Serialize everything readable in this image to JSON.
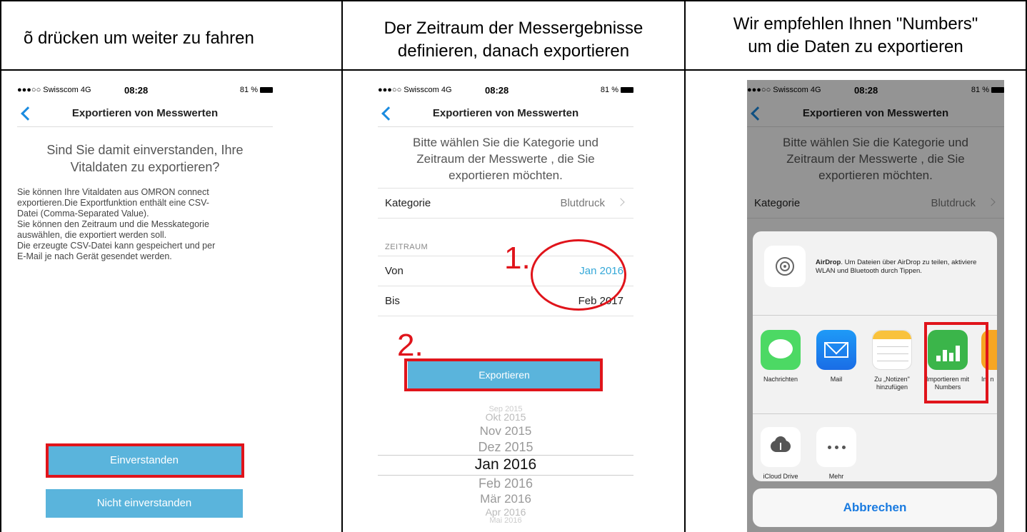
{
  "columns": [
    {
      "title": "õ  drücken um weiter zu fahren"
    },
    {
      "title_line1": "Der Zeitraum der Messergebnisse",
      "title_line2": "definieren, danach exportieren"
    },
    {
      "title_line1": "Wir empfehlen Ihnen \"Numbers\"",
      "title_line2": "um die Daten zu exportieren"
    }
  ],
  "status": {
    "carrier": "●●●○○ Swisscom  4G",
    "time": "08:28",
    "battery": "81 %"
  },
  "nav_title": "Exportieren von Messwerten",
  "screen1": {
    "question_line1": "Sind Sie damit einverstanden, Ihre",
    "question_line2": "Vitaldaten zu exportieren?",
    "body_lines": [
      "Sie können Ihre Vitaldaten aus OMRON connect",
      "exportieren.Die Exportfunktion enthält eine CSV-",
      "Datei (Comma-Separated Value).",
      "Sie können den Zeitraum und die Messkategorie",
      "auswählen, die exportiert werden soll.",
      "Die erzeugte CSV-Datei kann gespeichert und per",
      "E-Mail je nach Gerät gesendet werden."
    ],
    "agree_label": "Einverstanden",
    "disagree_label": "Nicht einverstanden"
  },
  "screen2": {
    "intro_line1": "Bitte wählen Sie die Kategorie und",
    "intro_line2": "Zeitraum der Messwerte , die Sie",
    "intro_line3": "exportieren möchten.",
    "category_label": "Kategorie",
    "category_value": "Blutdruck",
    "section_header": "ZEITRAUM",
    "from_label": "Von",
    "from_value": "Jan 2016",
    "to_label": "Bis",
    "to_value": "Feb 2017",
    "export_label": "Exportieren",
    "picker": [
      "Sep 2015",
      "Okt 2015",
      "Nov 2015",
      "Dez 2015",
      "Jan 2016",
      "Feb 2016",
      "Mär 2016",
      "Apr 2016",
      "Mai 2016"
    ]
  },
  "annotations": {
    "step1": "1.",
    "step2": "2.",
    "color": "#e0141b"
  },
  "screen3": {
    "airdrop_bold": "AirDrop",
    "airdrop_text": ". Um Dateien über AirDrop zu teilen, aktiviere WLAN und Bluetooth durch Tippen.",
    "apps": [
      {
        "label": "Nachrichten",
        "icon": "messages-icon"
      },
      {
        "label": "Mail",
        "icon": "mail-icon"
      },
      {
        "label": "Zu „Notizen\" hinzufügen",
        "icon": "notes-icon"
      },
      {
        "label": "Importieren mit Numbers",
        "icon": "numbers-icon"
      },
      {
        "label": "Im n",
        "icon": "partial-app-icon"
      }
    ],
    "actions": [
      {
        "label": "iCloud Drive",
        "icon": "icloud-icon"
      },
      {
        "label": "Mehr",
        "icon": "more-icon"
      }
    ],
    "cancel_label": "Abbrechen"
  },
  "colors": {
    "ios_blue": "#1a8be0",
    "button": "#5ab4dc",
    "highlight": "#e0141b"
  }
}
